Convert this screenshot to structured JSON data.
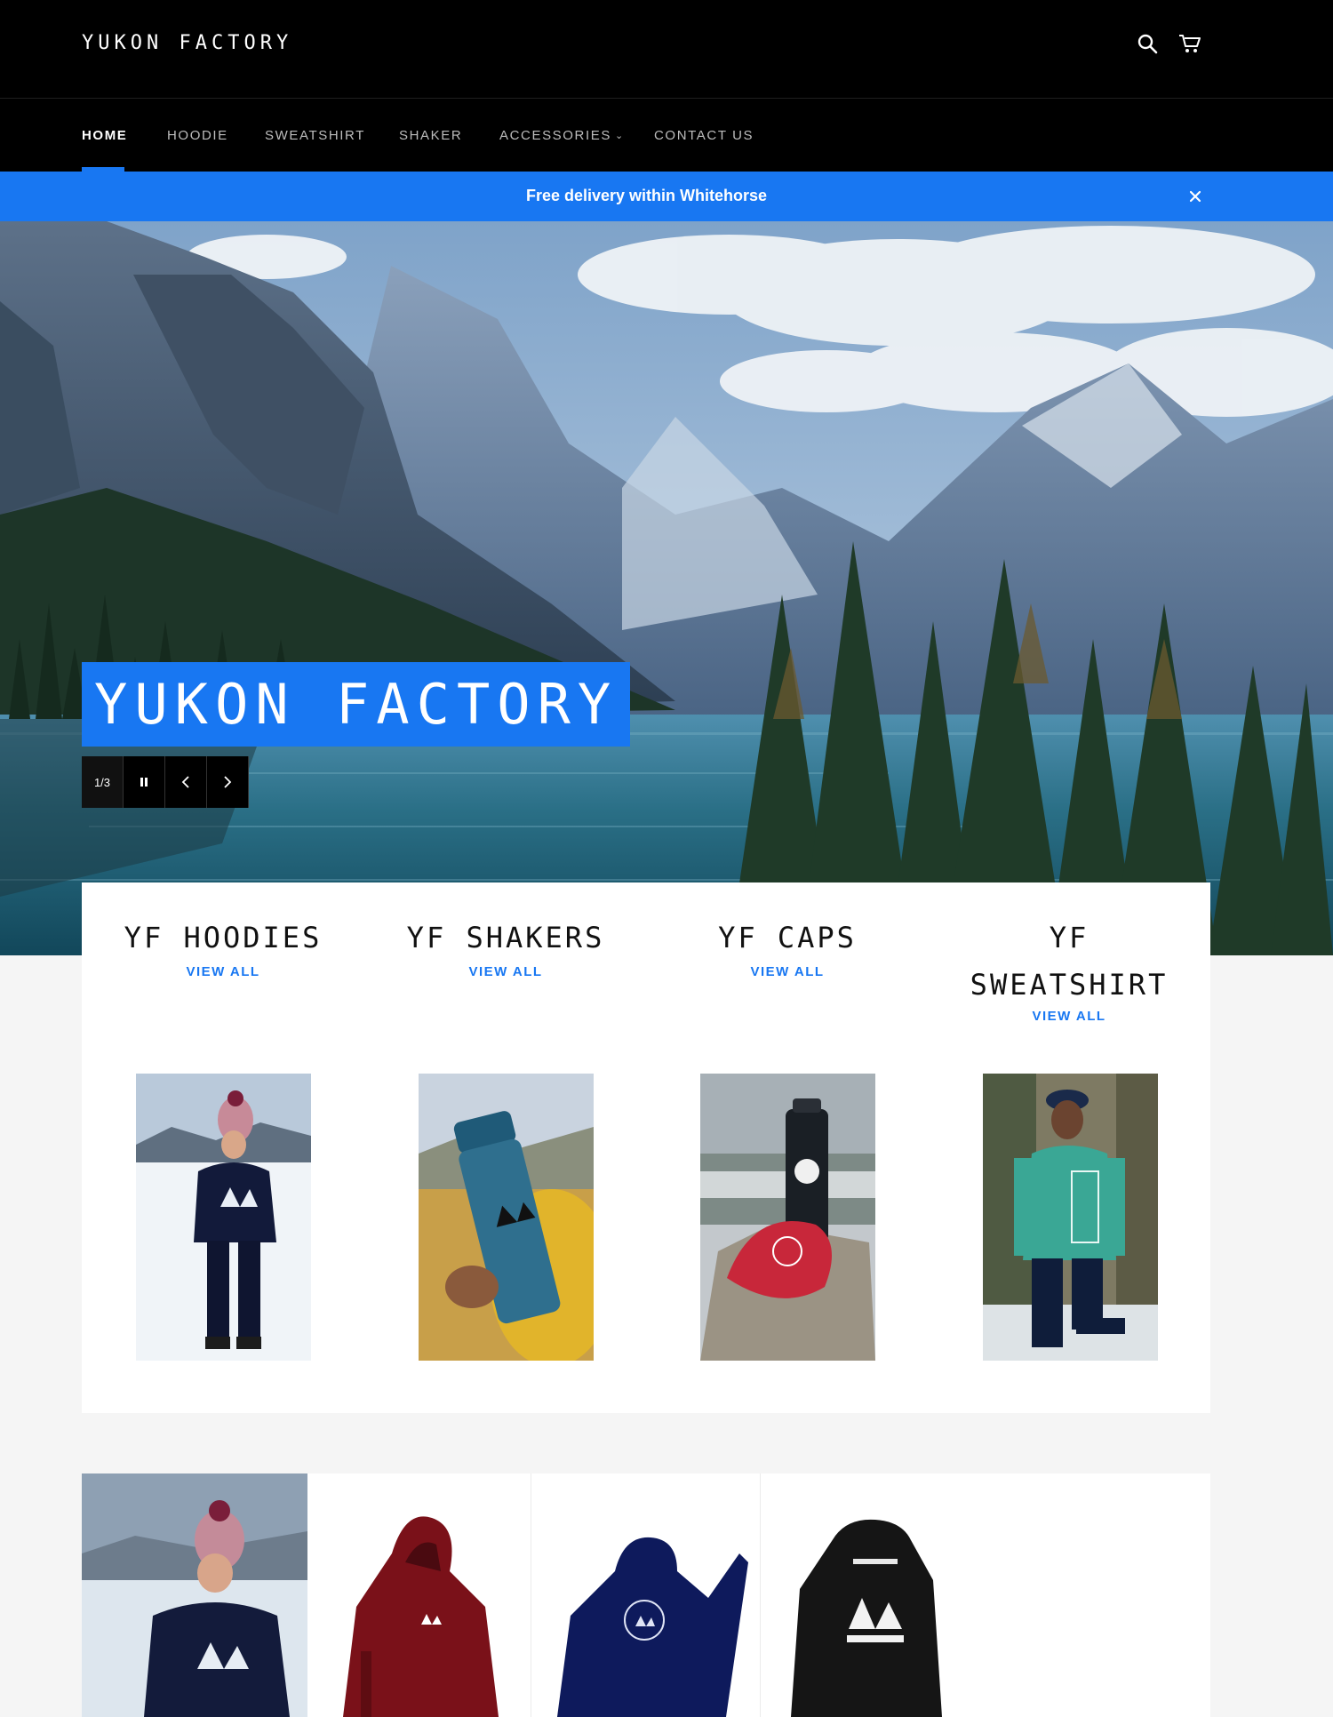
{
  "header": {
    "logo": "YUKON FACTORY",
    "nav": [
      {
        "label": "HOME",
        "active": true
      },
      {
        "label": "HOODIE"
      },
      {
        "label": "SWEATSHIRT"
      },
      {
        "label": "SHAKER"
      },
      {
        "label": "ACCESSORIES",
        "dropdown": true
      },
      {
        "label": "CONTACT US"
      }
    ],
    "icons": [
      "search-icon",
      "cart-icon"
    ]
  },
  "announcement": {
    "text": "Free delivery within Whitehorse",
    "close_icon": "close-icon"
  },
  "hero": {
    "title": "YUKON FACTORY",
    "slide_counter": "1/3",
    "controls": [
      "pause-icon",
      "chevron-left-icon",
      "chevron-right-icon"
    ]
  },
  "collections": [
    {
      "title": "YF HOODIES",
      "link": "VIEW ALL"
    },
    {
      "title": "YF SHAKERS",
      "link": "VIEW ALL"
    },
    {
      "title": "YF CAPS",
      "link": "VIEW ALL"
    },
    {
      "title_line1": "YF",
      "title_line2": "SWEATSHIRT",
      "link": "VIEW ALL"
    }
  ],
  "colors": {
    "accent": "#1877f2",
    "header_bg": "#000000",
    "page_bg": "#f5f5f5",
    "hoodie_red": "#7a1119",
    "hoodie_navy": "#0e1a5c",
    "hoodie_black": "#151515"
  }
}
